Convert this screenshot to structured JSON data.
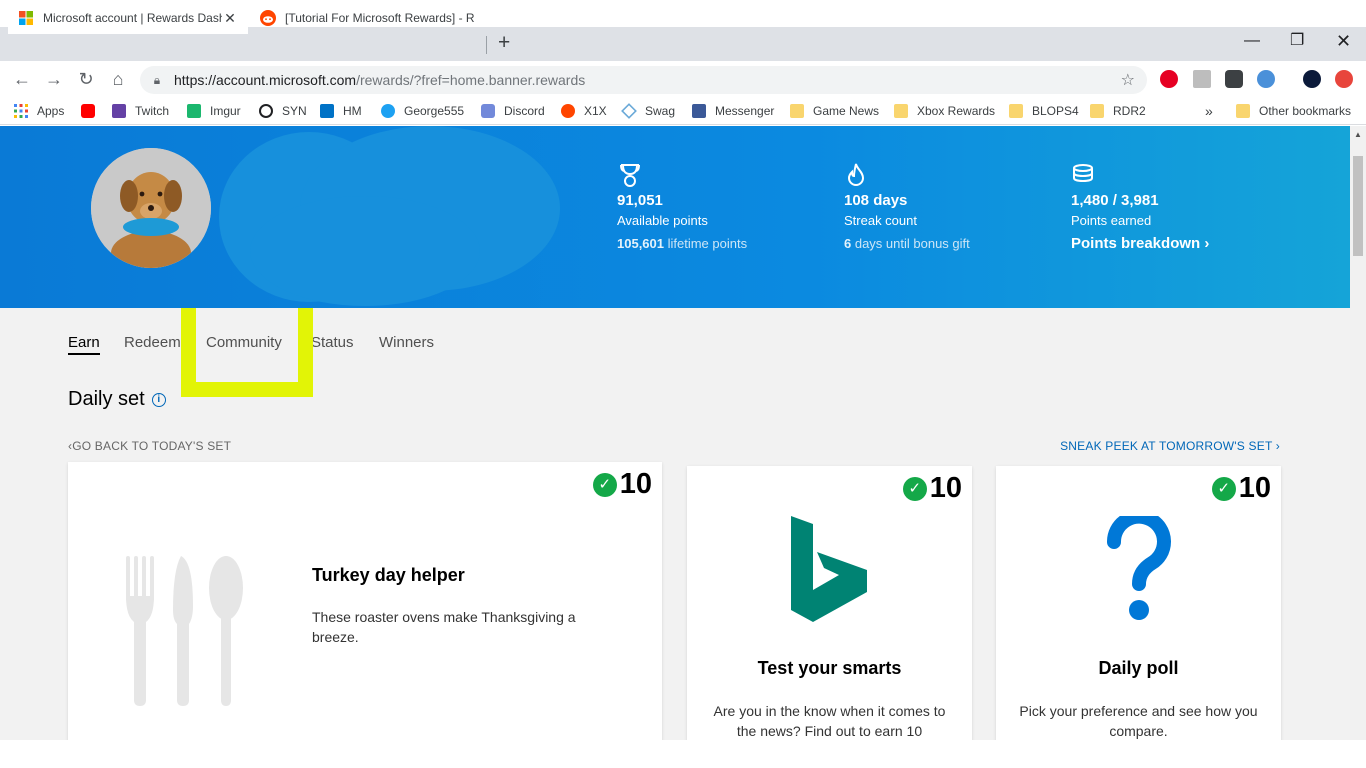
{
  "browser": {
    "tabs": [
      {
        "title": "Microsoft account | Rewards Dashboard",
        "active": true
      },
      {
        "title": "[Tutorial For Microsoft Rewards] - Reddit",
        "active": false
      }
    ],
    "url_host": "https://account.microsoft.com",
    "url_path": "/rewards/?fref=home.banner.rewards",
    "bookmarks": [
      {
        "label": "Apps",
        "icon": "apps-grid-icon"
      },
      {
        "label": "",
        "icon": "youtube-icon"
      },
      {
        "label": "Twitch",
        "icon": "twitch-icon"
      },
      {
        "label": "Imgur",
        "icon": "imgur-icon"
      },
      {
        "label": "SYN",
        "icon": "syn-icon"
      },
      {
        "label": "HM",
        "icon": "outlook-icon"
      },
      {
        "label": "George555",
        "icon": "twitter-icon"
      },
      {
        "label": "Discord",
        "icon": "discord-icon"
      },
      {
        "label": "X1X",
        "icon": "reddit-icon"
      },
      {
        "label": "Swag",
        "icon": "swag-icon"
      },
      {
        "label": "Messenger",
        "icon": "facebook-icon"
      },
      {
        "label": "Game News",
        "icon": "folder-icon"
      },
      {
        "label": "Xbox Rewards",
        "icon": "folder-icon"
      },
      {
        "label": "BLOPS4",
        "icon": "folder-icon"
      },
      {
        "label": "RDR2",
        "icon": "folder-icon"
      }
    ],
    "overflow": "»",
    "other_bookmarks": "Other bookmarks"
  },
  "hero": {
    "stats": [
      {
        "icon": "trophy-icon",
        "value": "91,051",
        "label": "Available points",
        "sub_bold": "105,601",
        "sub_rest": " lifetime points"
      },
      {
        "icon": "flame-icon",
        "value": "108 days",
        "label": "Streak count",
        "sub_bold": "6",
        "sub_rest": " days until bonus gift"
      },
      {
        "icon": "coins-stack-icon",
        "value": "1,480 / 3,981",
        "label": "Points earned",
        "link": "Points breakdown ›"
      }
    ]
  },
  "nav": {
    "tabs": [
      "Earn",
      "Redeem",
      "Community",
      "Status",
      "Winners"
    ],
    "active": "Earn"
  },
  "daily_set": {
    "title": "Daily set",
    "back_link": "‹GO BACK TO TODAY'S SET",
    "peek_link": "SNEAK PEEK AT TOMORROW'S SET ›",
    "cards": [
      {
        "points": "10",
        "title": "Turkey day helper",
        "description": "These roaster ovens make Thanksgiving a breeze.",
        "image": "cutlery-icon"
      },
      {
        "points": "10",
        "title": "Test your smarts",
        "description": "Are you in the know when it comes to the news? Find out to earn 10",
        "image": "bing-logo-icon"
      },
      {
        "points": "10",
        "title": "Daily poll",
        "description": "Pick your preference and see how you compare.",
        "image": "question-mark-icon"
      }
    ]
  },
  "colors": {
    "hero_blue": "#0b8ae0",
    "highlight": "#e2f406",
    "check_green": "#14a848",
    "bing_teal": "#008373",
    "poll_blue": "#0078d7",
    "link_blue": "#0067b8"
  }
}
